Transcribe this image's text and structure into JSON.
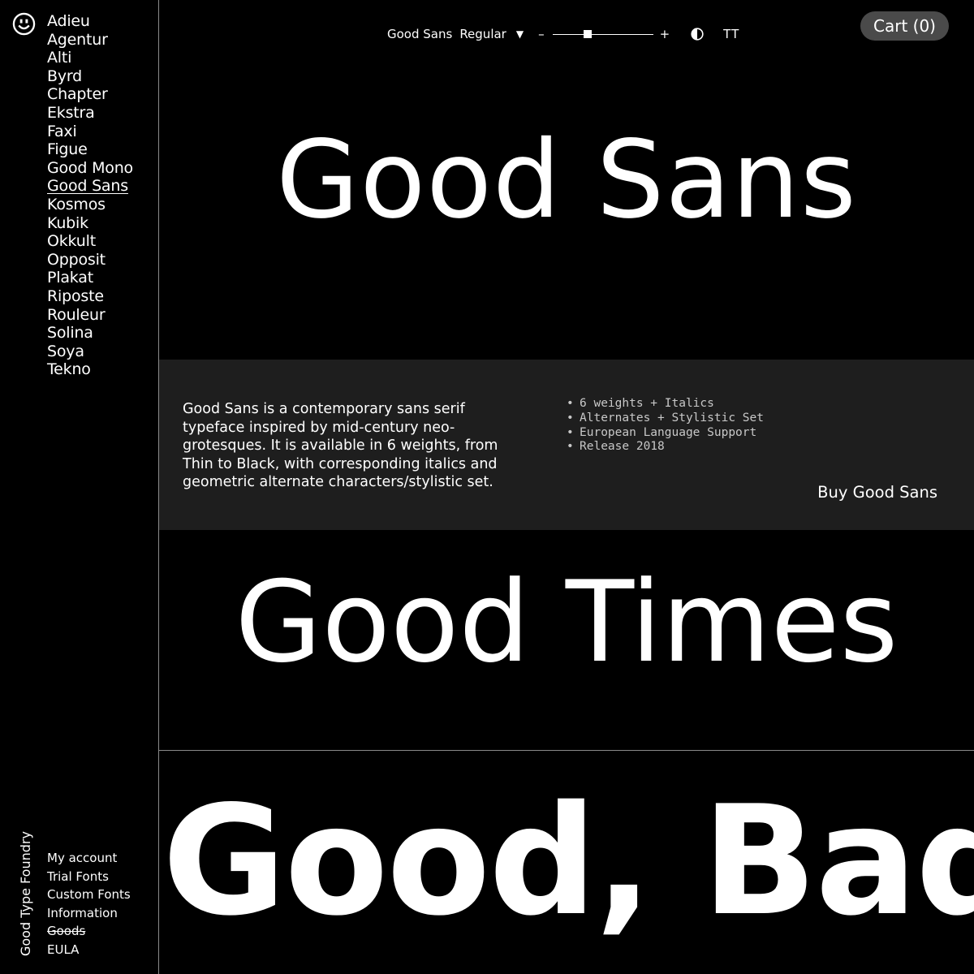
{
  "sidebar": {
    "logo_icon": "smiley-icon",
    "fonts": [
      "Adieu",
      "Agentur",
      "Alti",
      "Byrd",
      "Chapter",
      "Ekstra",
      "Faxi",
      "Figue",
      "Good Mono",
      "Good Sans",
      "Kosmos",
      "Kubik",
      "Okkult",
      "Opposit",
      "Plakat",
      "Riposte",
      "Rouleur",
      "Solina",
      "Soya",
      "Tekno"
    ],
    "active_font": "Good Sans",
    "brand": "Good Type Foundry",
    "footer_links": [
      "My account",
      "Trial Fonts",
      "Custom Fonts",
      "Information",
      "Goods",
      "EULA"
    ],
    "struck_link": "Goods"
  },
  "toolbar": {
    "font_name": "Good Sans",
    "weight": "Regular",
    "caret": "▼",
    "minus": "–",
    "plus": "+",
    "size_level": 0.35,
    "contrast_icon": "contrast-icon",
    "case_toggle": "TT"
  },
  "cart": {
    "label": "Cart (0)"
  },
  "specimens": {
    "first": "Good Sans",
    "second": "Good Times",
    "third": "Good, Bad"
  },
  "info": {
    "description": "Good Sans is a contemporary sans serif typeface inspired by mid-century neo-grotesques. It is available in 6 weights, from Thin to Black, with corresponding italics and geometric alternate characters/stylistic set.",
    "features": [
      "6 weights + Italics",
      "Alternates + Stylistic Set",
      "European Language Support",
      "Release 2018"
    ],
    "buy_label": "Buy Good Sans"
  },
  "colors": {
    "background": "#000000",
    "panel": "#1e1e1e",
    "cart_bg": "#4a4a4a",
    "text": "#ffffff"
  }
}
